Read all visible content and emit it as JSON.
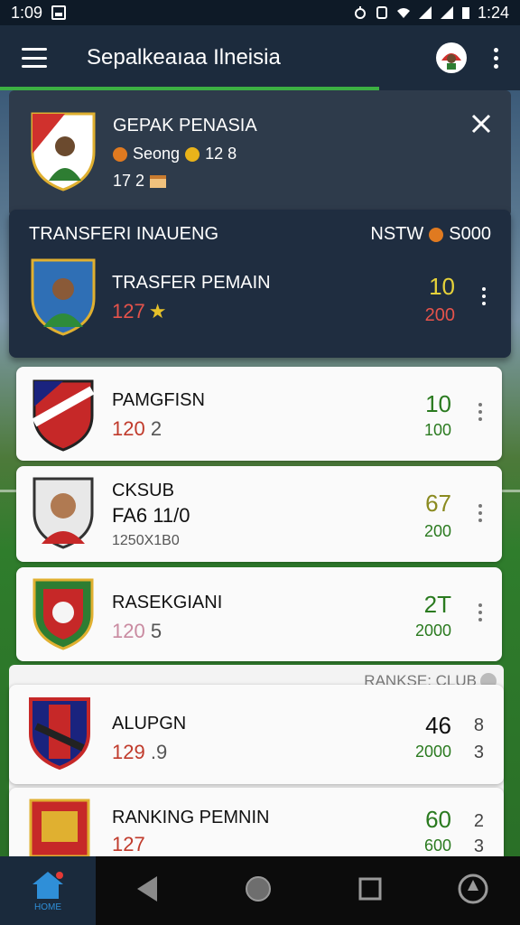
{
  "status_bar": {
    "time_left": "1:09",
    "time_right": "1:24"
  },
  "app_bar": {
    "title": "Sepalkeaıaa Ilneisia"
  },
  "player_card": {
    "name": "GEPAK PENASIA",
    "stat1_label": "Seong",
    "stat1_value": "12 8",
    "stat2_value": "17 2"
  },
  "transfer_panel": {
    "title": "TRANSFERI INAUENG",
    "right_label": "NSTW",
    "right_value": "S000",
    "player_name": "TRASFER PEMAIN",
    "player_sub": "127",
    "value_top": "10",
    "value_bottom": "200"
  },
  "list": [
    {
      "name": "PAMGFISN",
      "sub_red": "120",
      "sub_gray": "2",
      "value_top": "10",
      "value_bottom": "100"
    },
    {
      "name": "CKSUB",
      "line2": "FA6 11/0",
      "line3": "1250X1B0",
      "value_top": "67",
      "value_bottom": "200"
    },
    {
      "name": "RASEKGIANI",
      "sub_red": "120",
      "sub_gray": "5",
      "value_top": "2T",
      "value_bottom": "2000"
    }
  ],
  "big_card": {
    "rank_label": "RANKSE: CLUB",
    "rows": [
      {
        "name": "ALUPGN",
        "sub_red": "129",
        "sub_gray": ".9",
        "value_top": "46",
        "value_bottom": "2000",
        "col2_top": "8",
        "col2_bottom": "3"
      },
      {
        "name": "RANKING PEMNIN",
        "sub_red": "127",
        "value_top": "60",
        "value_bottom": "600",
        "col2_top": "2",
        "col2_bottom": "3"
      }
    ]
  },
  "bottom_nav": {
    "home_label": "HOME"
  },
  "colors": {
    "accent_green": "#3cb043",
    "panel_dark": "#1f2d40",
    "value_green": "#2a7a1f",
    "value_red": "#c03a2b"
  }
}
